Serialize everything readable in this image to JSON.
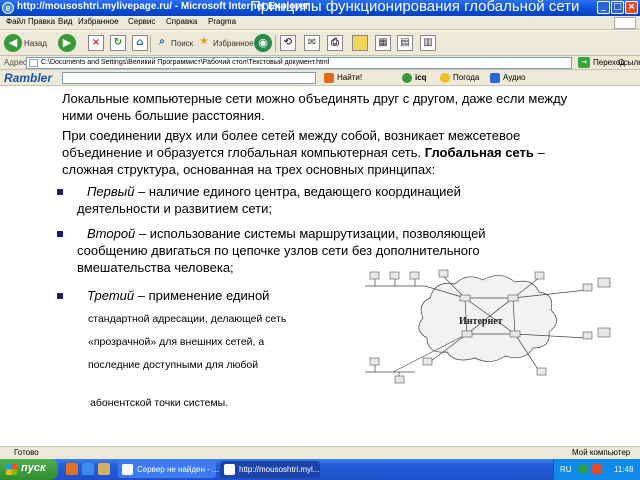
{
  "window": {
    "title": "http://mousoshtri.mylivepage.ru/ - Microsoft Internet Explorer",
    "slide_title": "Принципы функционирования глобальной сети"
  },
  "menu": [
    "Файл",
    "Правка",
    "Вид",
    "Избранное",
    "Сервис",
    "Справка",
    "Pragma"
  ],
  "toolbar": {
    "back_label": "Назад",
    "search_label": "Поиск",
    "favorites_label": "Избранное"
  },
  "address": {
    "label": "Адрес:",
    "url": "C:\\Documents and Settings\\Великий Программист\\Рабочий стол\\Текстовый документ.html",
    "go_label": "Переход",
    "links_label": "Ссылки"
  },
  "rambler": {
    "logo": "Rambler",
    "find_label": "Найти!",
    "icq_label": "icq",
    "weather_label": "Погода",
    "audio_label": "Аудио"
  },
  "content": {
    "intro": "Локальные компьютерные сети можно объединять друг с другом, даже если между ними очень большие расстояния.",
    "p2_start": "При соединении двух или более сетей между собой, возникает межсетевое объединение и образуется глобальная компьютерная сеть. ",
    "p2_bold": "Глобальная сеть",
    "p2_end": " – сложная структура, основанная на трех основных принципах:",
    "b1_lead": "Первый",
    "b1_text": " – наличие единого центра, ведающего координацией деятельности и развитием сети;",
    "b2_lead": "Второй",
    "b2_text": " – использование системы маршрутизации, позволяющей сообщению двигаться по цепочке узлов сети без дополнительного вмешательства человека;",
    "b3_lead": "Третий",
    "b3_text": " – применение единой",
    "b3_line2": "стандартной адресации, делающей сеть",
    "b3_line3": "«прозрачной» для внешних сетей, а",
    "b3_line4": "последние доступными для любой",
    "b3_line5": "абонентской точки системы."
  },
  "diagram": {
    "cloud_label": "Интернет"
  },
  "status": {
    "left": "Готово",
    "right": "Мой компьютер"
  },
  "taskbar": {
    "start_label": "пуск",
    "tasks": [
      "Сервер не найден - ...",
      "http://mousoshtri.myl..."
    ],
    "lang": "RU",
    "clock": "11:48"
  }
}
